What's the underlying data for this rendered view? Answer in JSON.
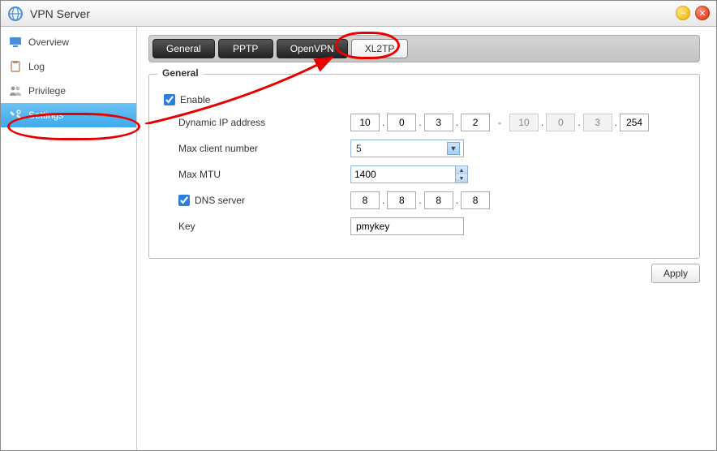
{
  "window": {
    "title": "VPN Server"
  },
  "sidebar": {
    "items": [
      {
        "label": "Overview"
      },
      {
        "label": "Log"
      },
      {
        "label": "Privilege"
      },
      {
        "label": "Settings"
      }
    ]
  },
  "tabs": [
    {
      "label": "General"
    },
    {
      "label": "PPTP"
    },
    {
      "label": "OpenVPN"
    },
    {
      "label": "XL2TP"
    }
  ],
  "panel": {
    "legend": "General",
    "enable_label": "Enable",
    "dyn_ip_label": "Dynamic IP address",
    "dyn_ip_start": [
      "10",
      "0",
      "3",
      "2"
    ],
    "dyn_ip_end": [
      "10",
      "0",
      "3",
      "254"
    ],
    "max_client_label": "Max client number",
    "max_client_value": "5",
    "max_mtu_label": "Max MTU",
    "max_mtu_value": "1400",
    "dns_label": "DNS server",
    "dns_value": [
      "8",
      "8",
      "8",
      "8"
    ],
    "key_label": "Key",
    "key_value": "pmykey"
  },
  "buttons": {
    "apply": "Apply"
  }
}
